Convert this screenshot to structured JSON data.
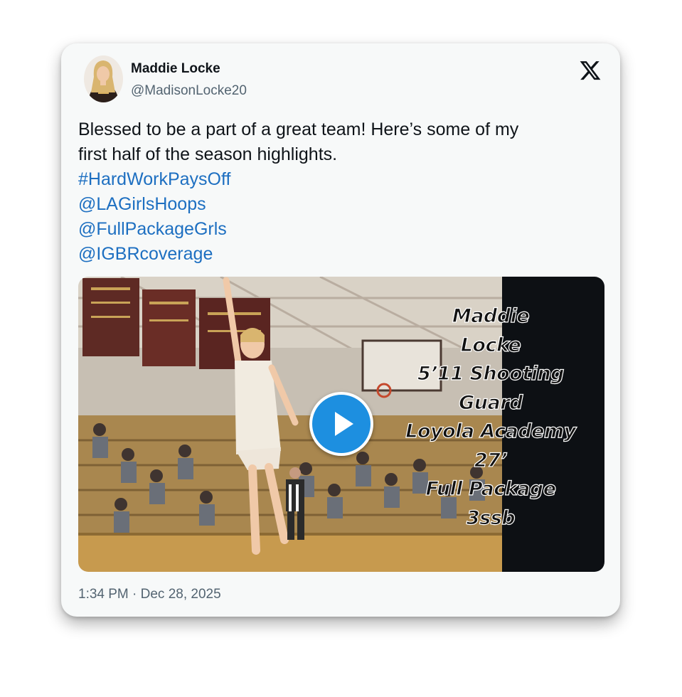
{
  "author": {
    "display_name": "Maddie Locke",
    "handle": "@MadisonLocke20",
    "avatar_icon": "profile-photo"
  },
  "brand": {
    "logo_icon": "x-logo-icon"
  },
  "tweet": {
    "text_lines": [
      "Blessed to be a part of a great team! Here’s some of my",
      "first half of the season highlights."
    ],
    "links": [
      "#HardWorkPaysOff",
      "@LAGirlsHoops",
      "@FullPackageGrls",
      "@IGBRcoverage"
    ],
    "link_color": "#1d6fc1"
  },
  "video": {
    "overlay_lines": [
      "Maddie",
      "Locke",
      "5’11 Shooting",
      "Guard",
      "Loyola Academy",
      "27’",
      "Full Package",
      "3ssb"
    ],
    "play_icon": "play-icon",
    "play_color": "#1d8fe0"
  },
  "timestamp": "1:34 PM · Dec 28, 2025"
}
